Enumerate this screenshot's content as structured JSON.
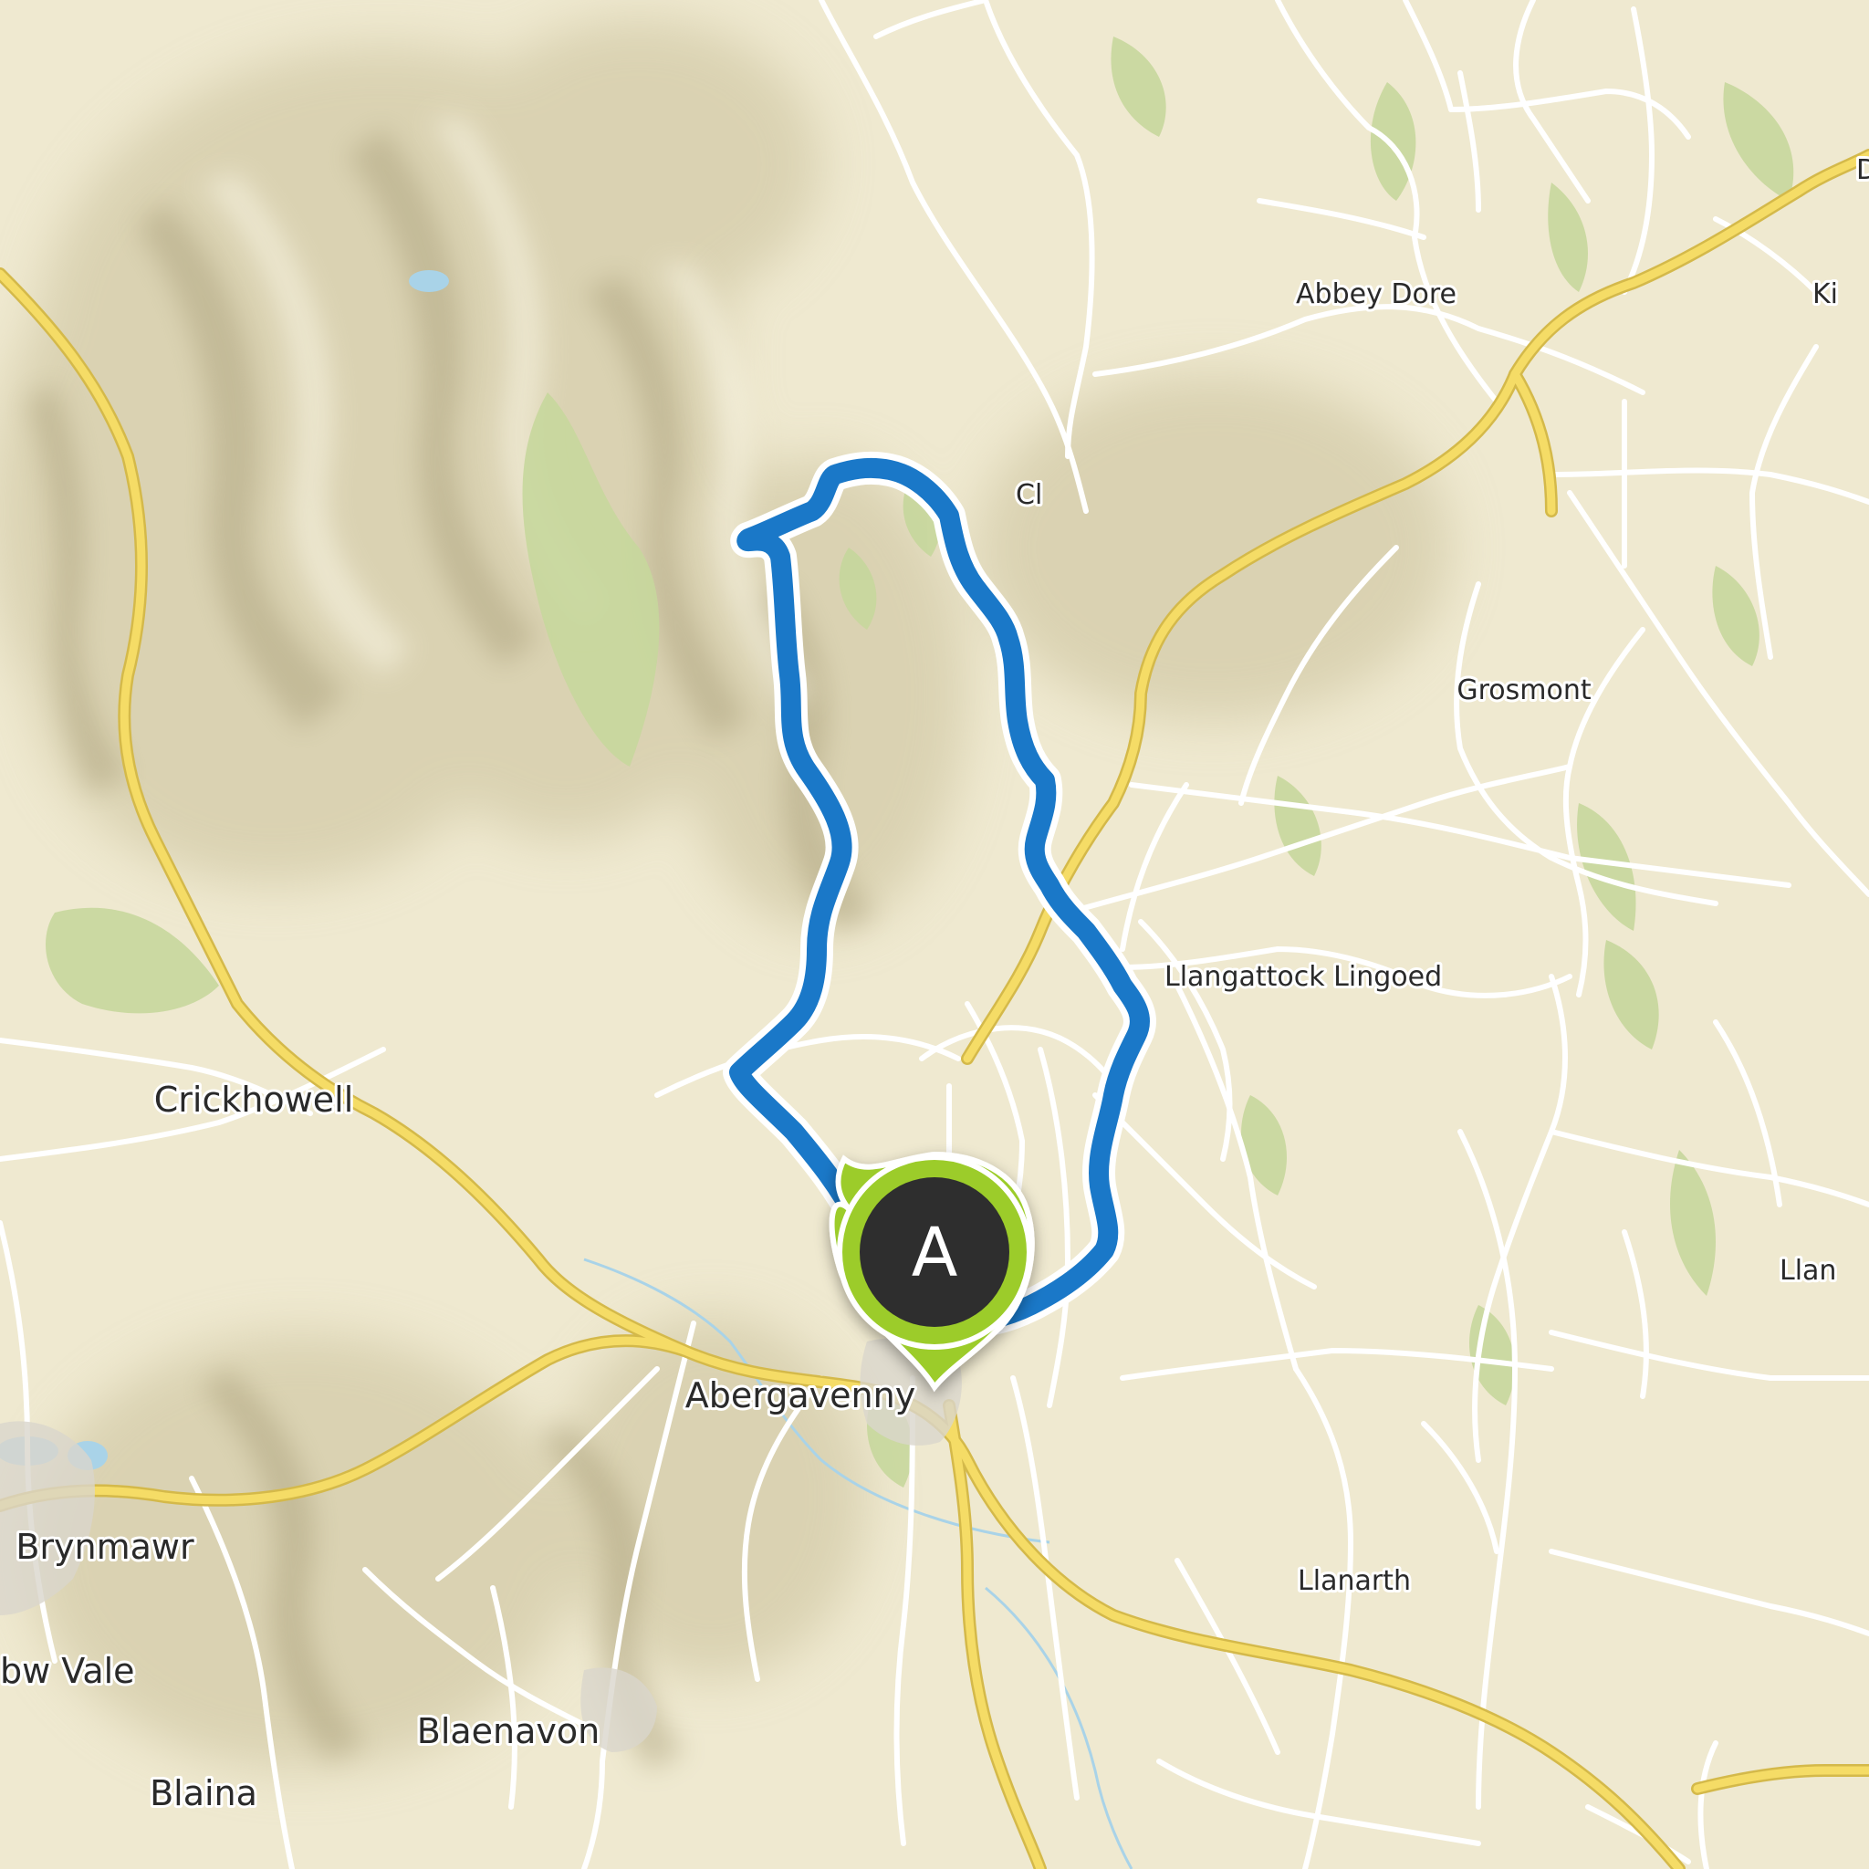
{
  "map": {
    "colors": {
      "land": "#efe9d0",
      "woodland": "#c8d9a0",
      "road_major": "#f2d864",
      "road_minor": "#ffffff",
      "route": "#1a78c8",
      "marker_fill": "#9ccc2a",
      "marker_inner": "#2f2f2f"
    },
    "places": [
      {
        "name": "Abergavenny"
      },
      {
        "name": "Crickhowell"
      },
      {
        "name": "Brynmawr"
      },
      {
        "name": "bw Vale"
      },
      {
        "name": "Blaenavon"
      },
      {
        "name": "Blaina"
      },
      {
        "name": "Llanarth"
      },
      {
        "name": "Llangattock Lingoed"
      },
      {
        "name": "Grosmont"
      },
      {
        "name": "Abbey Dore"
      },
      {
        "name": "Llan"
      },
      {
        "name": "Ki"
      },
      {
        "name": "Cl"
      },
      {
        "name": "D"
      }
    ],
    "marker": {
      "letter": "A",
      "icon": "map-pin-icon"
    },
    "route": {
      "icon": "route-loop"
    }
  }
}
